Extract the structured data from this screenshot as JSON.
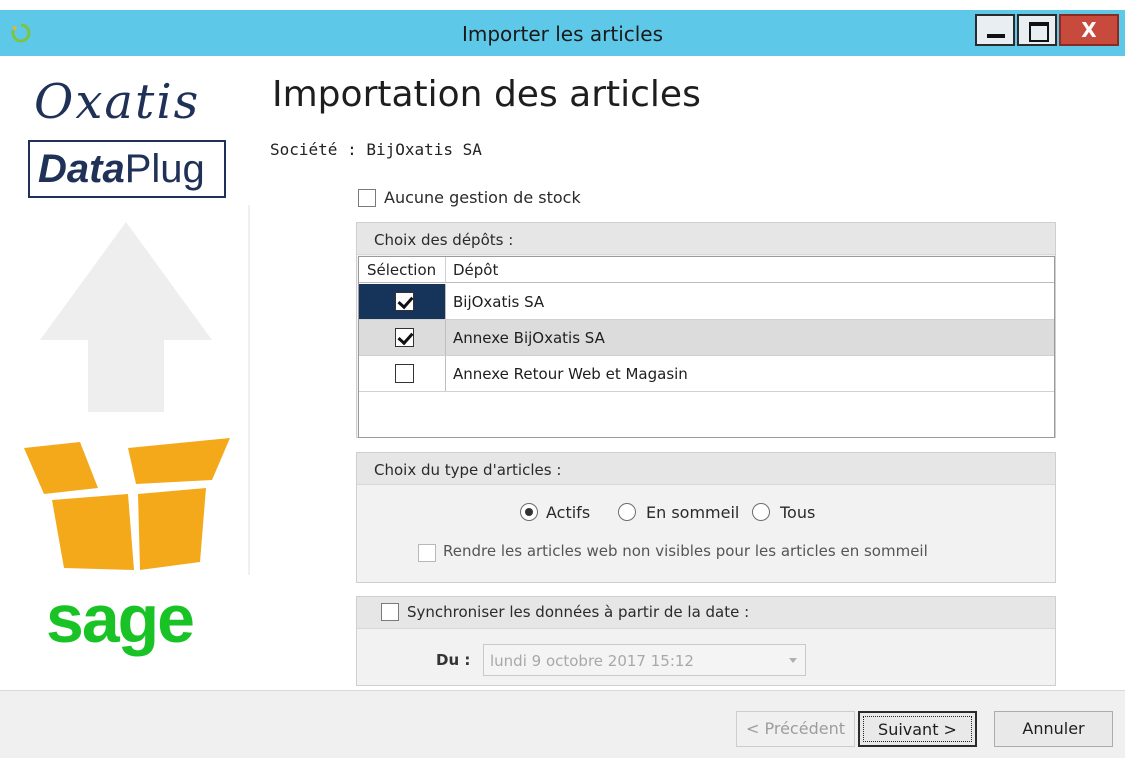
{
  "window": {
    "title": "Importer les articles",
    "close_glyph": "X"
  },
  "branding": {
    "oxatis": "Oxatis",
    "dataplug_bold": "Data",
    "dataplug_rest": "Plug",
    "sage": "sage"
  },
  "header": {
    "title": "Importation des articles",
    "company": "Société : BijOxatis SA"
  },
  "stock": {
    "label": "Aucune gestion de stock",
    "checked": false
  },
  "depots": {
    "group_label": "Choix des dépôts :",
    "columns": [
      "Sélection",
      "Dépôt"
    ],
    "rows": [
      {
        "name": "BijOxatis SA",
        "checked": true
      },
      {
        "name": "Annexe BijOxatis SA",
        "checked": true
      },
      {
        "name": "Annexe Retour Web et Magasin",
        "checked": false
      }
    ]
  },
  "article_type": {
    "group_label": "Choix du type d'articles :",
    "options": [
      "Actifs",
      "En sommeil",
      "Tous"
    ],
    "selected": "Actifs",
    "hidden_web_label": "Rendre les articles web non visibles pour les articles en sommeil"
  },
  "sync": {
    "label": "Synchroniser les données à partir de la date :",
    "du_label": "Du :",
    "date_value": "lundi 9 octobre 2017 15:12"
  },
  "footer": {
    "previous": "< Précédent",
    "next": "Suivant >",
    "cancel": "Annuler"
  },
  "colors": {
    "titlebar": "#5ec8e8",
    "brand_navy": "#1f3157",
    "sage_green": "#19c325",
    "box_orange": "#f4a91b",
    "selected_row": "#16335a"
  }
}
